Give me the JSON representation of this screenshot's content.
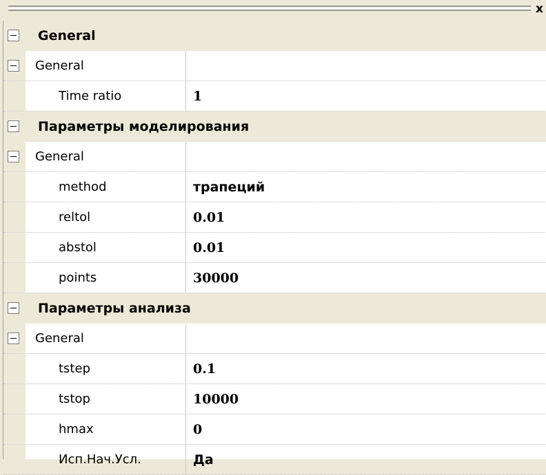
{
  "window": {
    "close_glyph": "x"
  },
  "categories": [
    {
      "label": "General",
      "group": {
        "label": "General",
        "props": [
          {
            "name": "Time ratio",
            "value": "1",
            "serif": true
          }
        ]
      }
    },
    {
      "label": "Параметры моделирования",
      "group": {
        "label": "General",
        "props": [
          {
            "name": "method",
            "value": "трапеций",
            "serif": false
          },
          {
            "name": "reltol",
            "value": "0.01",
            "serif": true
          },
          {
            "name": "abstol",
            "value": "0.01",
            "serif": true
          },
          {
            "name": "points",
            "value": "30000",
            "serif": true
          }
        ]
      }
    },
    {
      "label": "Параметры анализа",
      "group": {
        "label": "General",
        "props": [
          {
            "name": "tstep",
            "value": "0.1",
            "serif": true
          },
          {
            "name": "tstop",
            "value": "10000",
            "serif": true
          },
          {
            "name": "hmax",
            "value": "0",
            "serif": true
          },
          {
            "name": "Исп.Нач.Усл.",
            "value": "Да",
            "serif": false
          }
        ]
      }
    }
  ]
}
